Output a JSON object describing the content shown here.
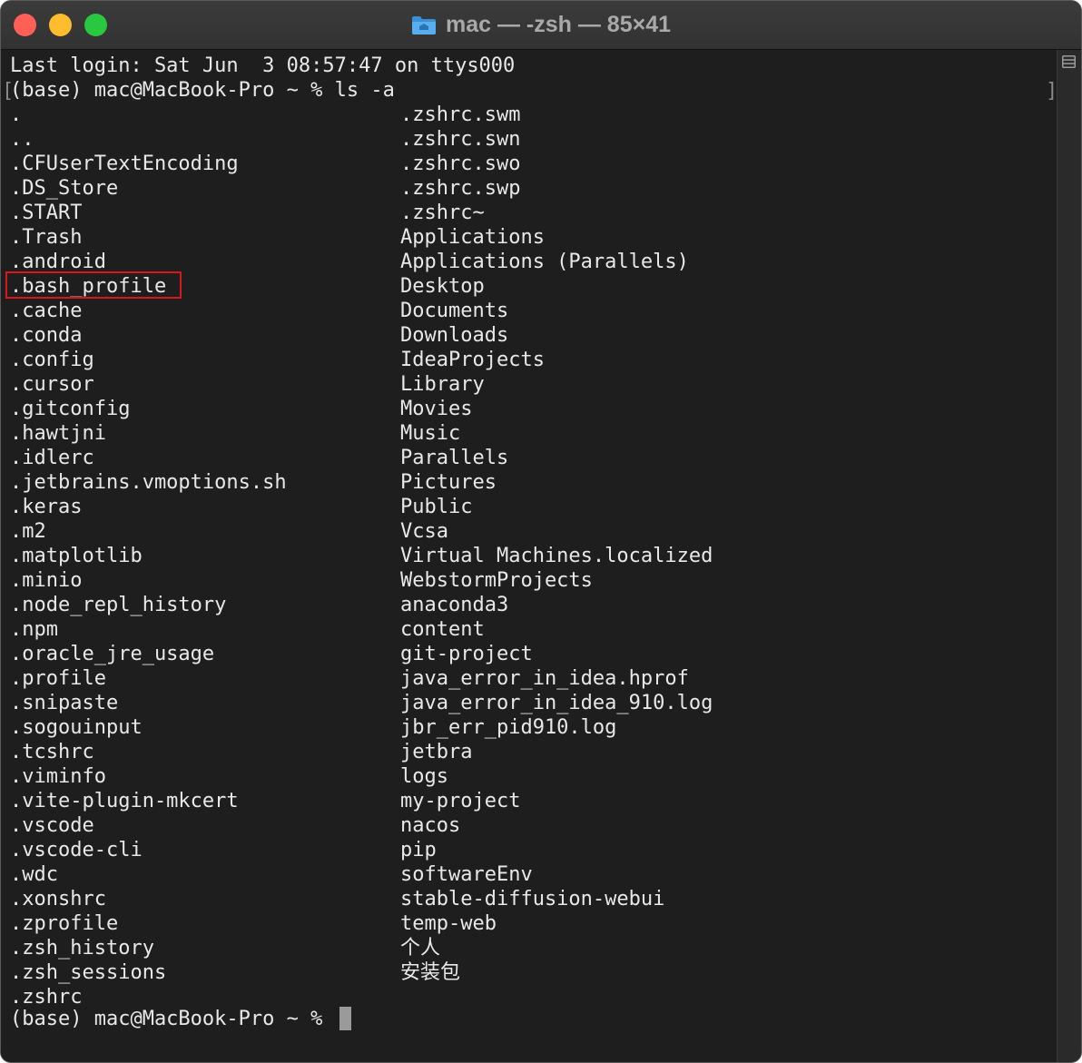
{
  "window": {
    "title": "mac — -zsh — 85×41"
  },
  "terminal": {
    "last_login": "Last login: Sat Jun  3 08:57:47 on ttys000",
    "command_prompt": "(base) mac@MacBook-Pro ~ % ls -a",
    "left_column": [
      ".",
      "..",
      ".CFUserTextEncoding",
      ".DS_Store",
      ".START",
      ".Trash",
      ".android",
      ".bash_profile",
      ".cache",
      ".conda",
      ".config",
      ".cursor",
      ".gitconfig",
      ".hawtjni",
      ".idlerc",
      ".jetbrains.vmoptions.sh",
      ".keras",
      ".m2",
      ".matplotlib",
      ".minio",
      ".node_repl_history",
      ".npm",
      ".oracle_jre_usage",
      ".profile",
      ".snipaste",
      ".sogouinput",
      ".tcshrc",
      ".viminfo",
      ".vite-plugin-mkcert",
      ".vscode",
      ".vscode-cli",
      ".wdc",
      ".xonshrc",
      ".zprofile",
      ".zsh_history",
      ".zsh_sessions",
      ".zshrc"
    ],
    "right_column": [
      ".zshrc.swm",
      ".zshrc.swn",
      ".zshrc.swo",
      ".zshrc.swp",
      ".zshrc~",
      "Applications",
      "Applications (Parallels)",
      "Desktop",
      "Documents",
      "Downloads",
      "IdeaProjects",
      "Library",
      "Movies",
      "Music",
      "Parallels",
      "Pictures",
      "Public",
      "Vcsa",
      "Virtual Machines.localized",
      "WebstormProjects",
      "anaconda3",
      "content",
      "git-project",
      "java_error_in_idea.hprof",
      "java_error_in_idea_910.log",
      "jbr_err_pid910.log",
      "jetbra",
      "logs",
      "my-project",
      "nacos",
      "pip",
      "softwareEnv",
      "stable-diffusion-webui",
      "temp-web",
      "个人",
      "安装包"
    ],
    "final_prompt": "(base) mac@MacBook-Pro ~ % "
  },
  "colors": {
    "background": "#1e1e1e",
    "text": "#e8e8e8",
    "highlight_border": "#d9171b",
    "close": "#fe5f57",
    "minimize": "#febc2e",
    "maximize": "#28c840"
  },
  "icons": {
    "title": "folder-icon",
    "scrollbar": "split-pane-icon"
  }
}
